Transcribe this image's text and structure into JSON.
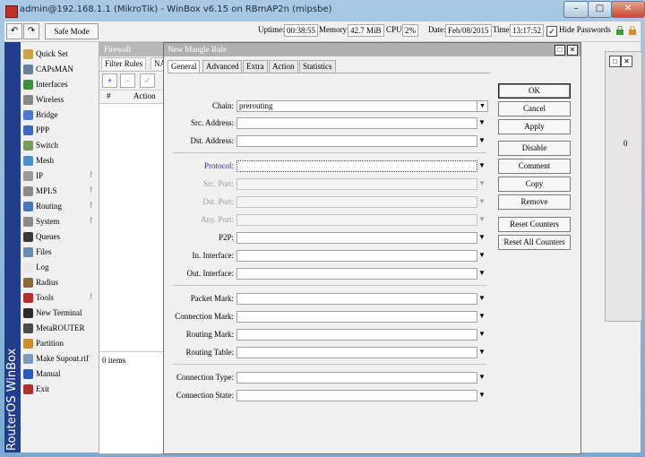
{
  "window": {
    "title": "admin@192.168.1.1 (MikroTik) - WinBox v6.15 on RBmAP2n (mipsbe)"
  },
  "caption_buttons": {
    "minimize": "–",
    "maximize": "□",
    "close": "✕"
  },
  "toolbar": {
    "undo": "↶",
    "redo": "↷",
    "safe_mode": "Safe Mode",
    "uptime_label": "Uptime:",
    "uptime": "00:38:55",
    "memory_label": "Memory:",
    "memory": "42.7 MiB",
    "cpu_label": "CPU:",
    "cpu": "2%",
    "date_label": "Date:",
    "date": "Feb/08/2015",
    "time_label": "Time:",
    "time": "13:17:52",
    "hide_passwords_checked": "✓",
    "hide_passwords": "Hide Passwords"
  },
  "sidebar": {
    "brand": "RouterOS WinBox",
    "items": [
      {
        "label": "Quick Set",
        "icon": "wand-icon",
        "color": "#caa24a"
      },
      {
        "label": "CAPsMAN",
        "icon": "capsman-icon",
        "color": "#6a7f9a"
      },
      {
        "label": "Interfaces",
        "icon": "interfaces-icon",
        "color": "#3f8f3f"
      },
      {
        "label": "Wireless",
        "icon": "wireless-icon",
        "color": "#888888"
      },
      {
        "label": "Bridge",
        "icon": "bridge-icon",
        "color": "#4a7bc8"
      },
      {
        "label": "PPP",
        "icon": "ppp-icon",
        "color": "#3f68b8"
      },
      {
        "label": "Switch",
        "icon": "switch-icon",
        "color": "#7c9a5e"
      },
      {
        "label": "Mesh",
        "icon": "mesh-icon",
        "color": "#4a8fc8"
      },
      {
        "label": "IP",
        "icon": "ip-icon",
        "color": "#9a9a9a",
        "submenu": "↾"
      },
      {
        "label": "MPLS",
        "icon": "mpls-icon",
        "color": "#8a8a8a",
        "submenu": "↾"
      },
      {
        "label": "Routing",
        "icon": "routing-icon",
        "color": "#4a78b8",
        "submenu": "↾"
      },
      {
        "label": "System",
        "icon": "system-icon",
        "color": "#8a8a8a",
        "submenu": "↾"
      },
      {
        "label": "Queues",
        "icon": "queues-icon",
        "color": "#3a3a3a"
      },
      {
        "label": "Files",
        "icon": "files-icon",
        "color": "#6a8ab0"
      },
      {
        "label": "Log",
        "icon": "log-icon",
        "color": "#e8e8e8"
      },
      {
        "label": "Radius",
        "icon": "radius-icon",
        "color": "#8a6a3a"
      },
      {
        "label": "Tools",
        "icon": "tools-icon",
        "color": "#b03030",
        "submenu": "↾"
      },
      {
        "label": "New Terminal",
        "icon": "terminal-icon",
        "color": "#2a2a2a"
      },
      {
        "label": "MetaROUTER",
        "icon": "metarouter-icon",
        "color": "#4a4a4a"
      },
      {
        "label": "Partition",
        "icon": "partition-icon",
        "color": "#c89030"
      },
      {
        "label": "Make Supout.rif",
        "icon": "supout-icon",
        "color": "#7a9ab8"
      },
      {
        "label": "Manual",
        "icon": "manual-icon",
        "color": "#2a5ab8"
      },
      {
        "label": "Exit",
        "icon": "exit-icon",
        "color": "#b03030"
      }
    ]
  },
  "firewall": {
    "title": "Firewall",
    "tabs": [
      "Filter Rules",
      "NA"
    ],
    "tools": {
      "add": "+",
      "remove": "–",
      "enable": "✓"
    },
    "columns": [
      "#",
      "Action"
    ],
    "count": "0 items"
  },
  "right_window": {
    "value": "0",
    "box1": "□",
    "box2": "✕"
  },
  "mangle": {
    "title": "New Mangle Rule",
    "title_buttons": {
      "maximize": "□",
      "close": "✕"
    },
    "tabs": [
      "General",
      "Advanced",
      "Extra",
      "Action",
      "Statistics"
    ],
    "fields": {
      "chain": {
        "label": "Chain:",
        "value": "prerouting"
      },
      "src_address": {
        "label": "Src. Address:"
      },
      "dst_address": {
        "label": "Dst. Address:"
      },
      "protocol": {
        "label": "Protocol:"
      },
      "src_port": {
        "label": "Src. Port:"
      },
      "dst_port": {
        "label": "Dst. Port:"
      },
      "any_port": {
        "label": "Any. Port:"
      },
      "p2p": {
        "label": "P2P:"
      },
      "in_interface": {
        "label": "In. Interface:"
      },
      "out_interface": {
        "label": "Out. Interface:"
      },
      "packet_mark": {
        "label": "Packet Mark:"
      },
      "connection_mark": {
        "label": "Connection Mark:"
      },
      "routing_mark": {
        "label": "Routing Mark:"
      },
      "routing_table": {
        "label": "Routing Table:"
      },
      "connection_type": {
        "label": "Connection Type:"
      },
      "connection_state": {
        "label": "Connection State:"
      }
    },
    "arrow_down": "▼",
    "dropdown_toggle": "▼",
    "buttons": [
      "OK",
      "Cancel",
      "Apply",
      "Disable",
      "Comment",
      "Copy",
      "Remove",
      "Reset Counters",
      "Reset All Counters"
    ]
  }
}
